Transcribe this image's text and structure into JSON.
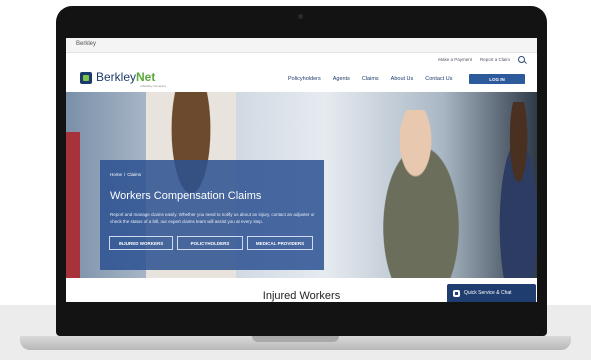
{
  "browser": {
    "brand": "Berkley"
  },
  "utility": {
    "make_payment": "Make a Payment",
    "report_claim": "Report a Claim"
  },
  "nav": {
    "logo_main": "Berkley",
    "logo_accent": "Net",
    "logo_sub": "a Berkley Company",
    "items": [
      "Policyholders",
      "Agents",
      "Claims",
      "About Us",
      "Contact Us"
    ],
    "login": "LOG IN"
  },
  "hero": {
    "breadcrumb": {
      "home": "Home",
      "sep": "/",
      "current": "Claims"
    },
    "title": "Workers Compensation Claims",
    "description": "Report and manage claims easily. Whether you need to notify us about an injury, contact an adjuster or check the status of a bill, our expert claims team will assist you at every step.",
    "buttons": [
      "INJURED WORKERS",
      "POLICYHOLDERS",
      "MEDICAL PROVIDERS"
    ]
  },
  "section": {
    "title": "Injured Workers"
  },
  "chat": {
    "label": "Quick Service & Chat"
  },
  "colors": {
    "brand_navy": "#1d3b6a",
    "brand_green": "#5aa83a",
    "panel_blue": "#2c5291"
  }
}
